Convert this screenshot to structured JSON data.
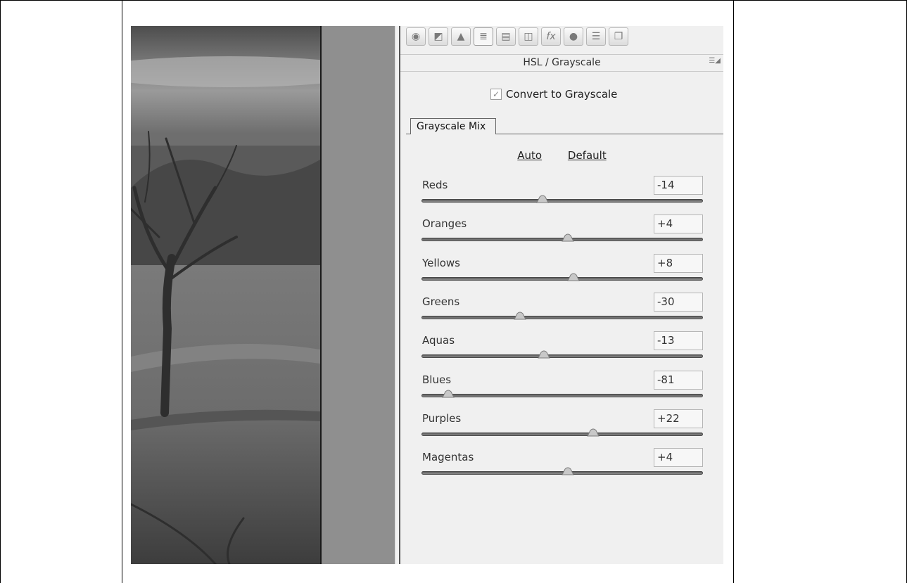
{
  "panel": {
    "title": "HSL / Grayscale",
    "menu_icon": "panel-menu-icon",
    "convert_label": "Convert to Grayscale",
    "convert_checked": true,
    "tab_label": "Grayscale Mix",
    "auto_label": "Auto",
    "default_label": "Default",
    "toolbar_icons": [
      "basic-icon",
      "tone-curve-icon",
      "detail-icon",
      "hsl-grayscale-icon",
      "split-toning-icon",
      "lens-corrections-icon",
      "effects-icon",
      "camera-calibration-icon",
      "presets-icon",
      "snapshots-icon"
    ],
    "sliders": [
      {
        "label": "Reds",
        "value": "-14",
        "level": -14
      },
      {
        "label": "Oranges",
        "value": "+4",
        "level": 4
      },
      {
        "label": "Yellows",
        "value": "+8",
        "level": 8
      },
      {
        "label": "Greens",
        "value": "-30",
        "level": -30
      },
      {
        "label": "Aquas",
        "value": "-13",
        "level": -13
      },
      {
        "label": "Blues",
        "value": "-81",
        "level": -81
      },
      {
        "label": "Purples",
        "value": "+22",
        "level": 22
      },
      {
        "label": "Magentas",
        "value": "+4",
        "level": 4
      }
    ]
  },
  "colors": {
    "panel_bg": "#f0f0f0",
    "thumb": "#c8c8c8",
    "track": "#6e6e6e"
  }
}
